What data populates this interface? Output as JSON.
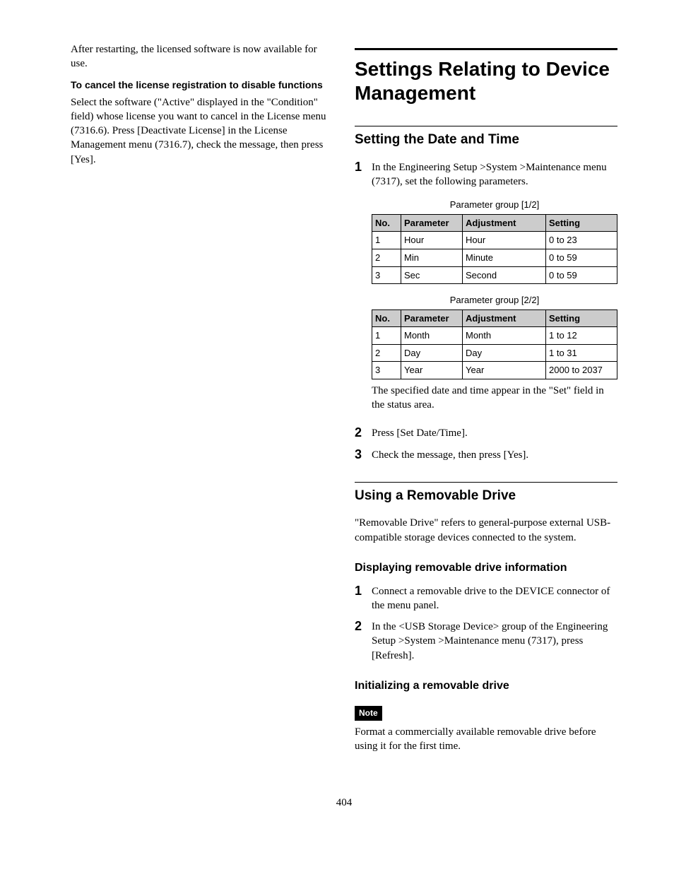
{
  "pageNumber": "404",
  "leftCol": {
    "intro": "After restarting, the licensed software is now available for use.",
    "cancelHeading": "To cancel the license registration to disable functions",
    "cancelBody": "Select the software (\"Active\" displayed in the \"Condition\" field) whose license you want to cancel in the License menu (7316.6). Press [Deactivate License] in the License Management menu (7316.7), check the message, then press [Yes]."
  },
  "rightCol": {
    "title": "Settings Relating to Device Management",
    "dateTime": {
      "heading": "Setting the Date and Time",
      "step1": "In the Engineering Setup >System >Maintenance menu (7317), set the following parameters.",
      "group1Label": "Parameter group [1/2]",
      "table1": {
        "headers": [
          "No.",
          "Parameter",
          "Adjustment",
          "Setting"
        ],
        "rows": [
          [
            "1",
            "Hour",
            "Hour",
            "0 to 23"
          ],
          [
            "2",
            "Min",
            "Minute",
            "0 to 59"
          ],
          [
            "3",
            "Sec",
            "Second",
            "0 to 59"
          ]
        ]
      },
      "group2Label": "Parameter group [2/2]",
      "table2": {
        "headers": [
          "No.",
          "Parameter",
          "Adjustment",
          "Setting"
        ],
        "rows": [
          [
            "1",
            "Month",
            "Month",
            "1 to 12"
          ],
          [
            "2",
            "Day",
            "Day",
            "1 to 31"
          ],
          [
            "3",
            "Year",
            "Year",
            "2000 to 2037"
          ]
        ]
      },
      "afterTable": "The specified date and time appear in the \"Set\" field in the status area.",
      "step2": "Press [Set Date/Time].",
      "step3": "Check the message, then press [Yes]."
    },
    "removable": {
      "heading": "Using a Removable Drive",
      "intro": "\"Removable Drive\" refers to general-purpose external USB-compatible storage devices connected to the system.",
      "displayHeading": "Displaying removable drive information",
      "displayStep1": "Connect a removable drive to the DEVICE connector of the menu panel.",
      "displayStep2": "In the <USB Storage Device> group of the Engineering Setup >System >Maintenance menu (7317), press [Refresh].",
      "initHeading": "Initializing a removable drive",
      "noteLabel": "Note",
      "noteBody": "Format a commercially available removable drive before using it for the first time."
    }
  }
}
